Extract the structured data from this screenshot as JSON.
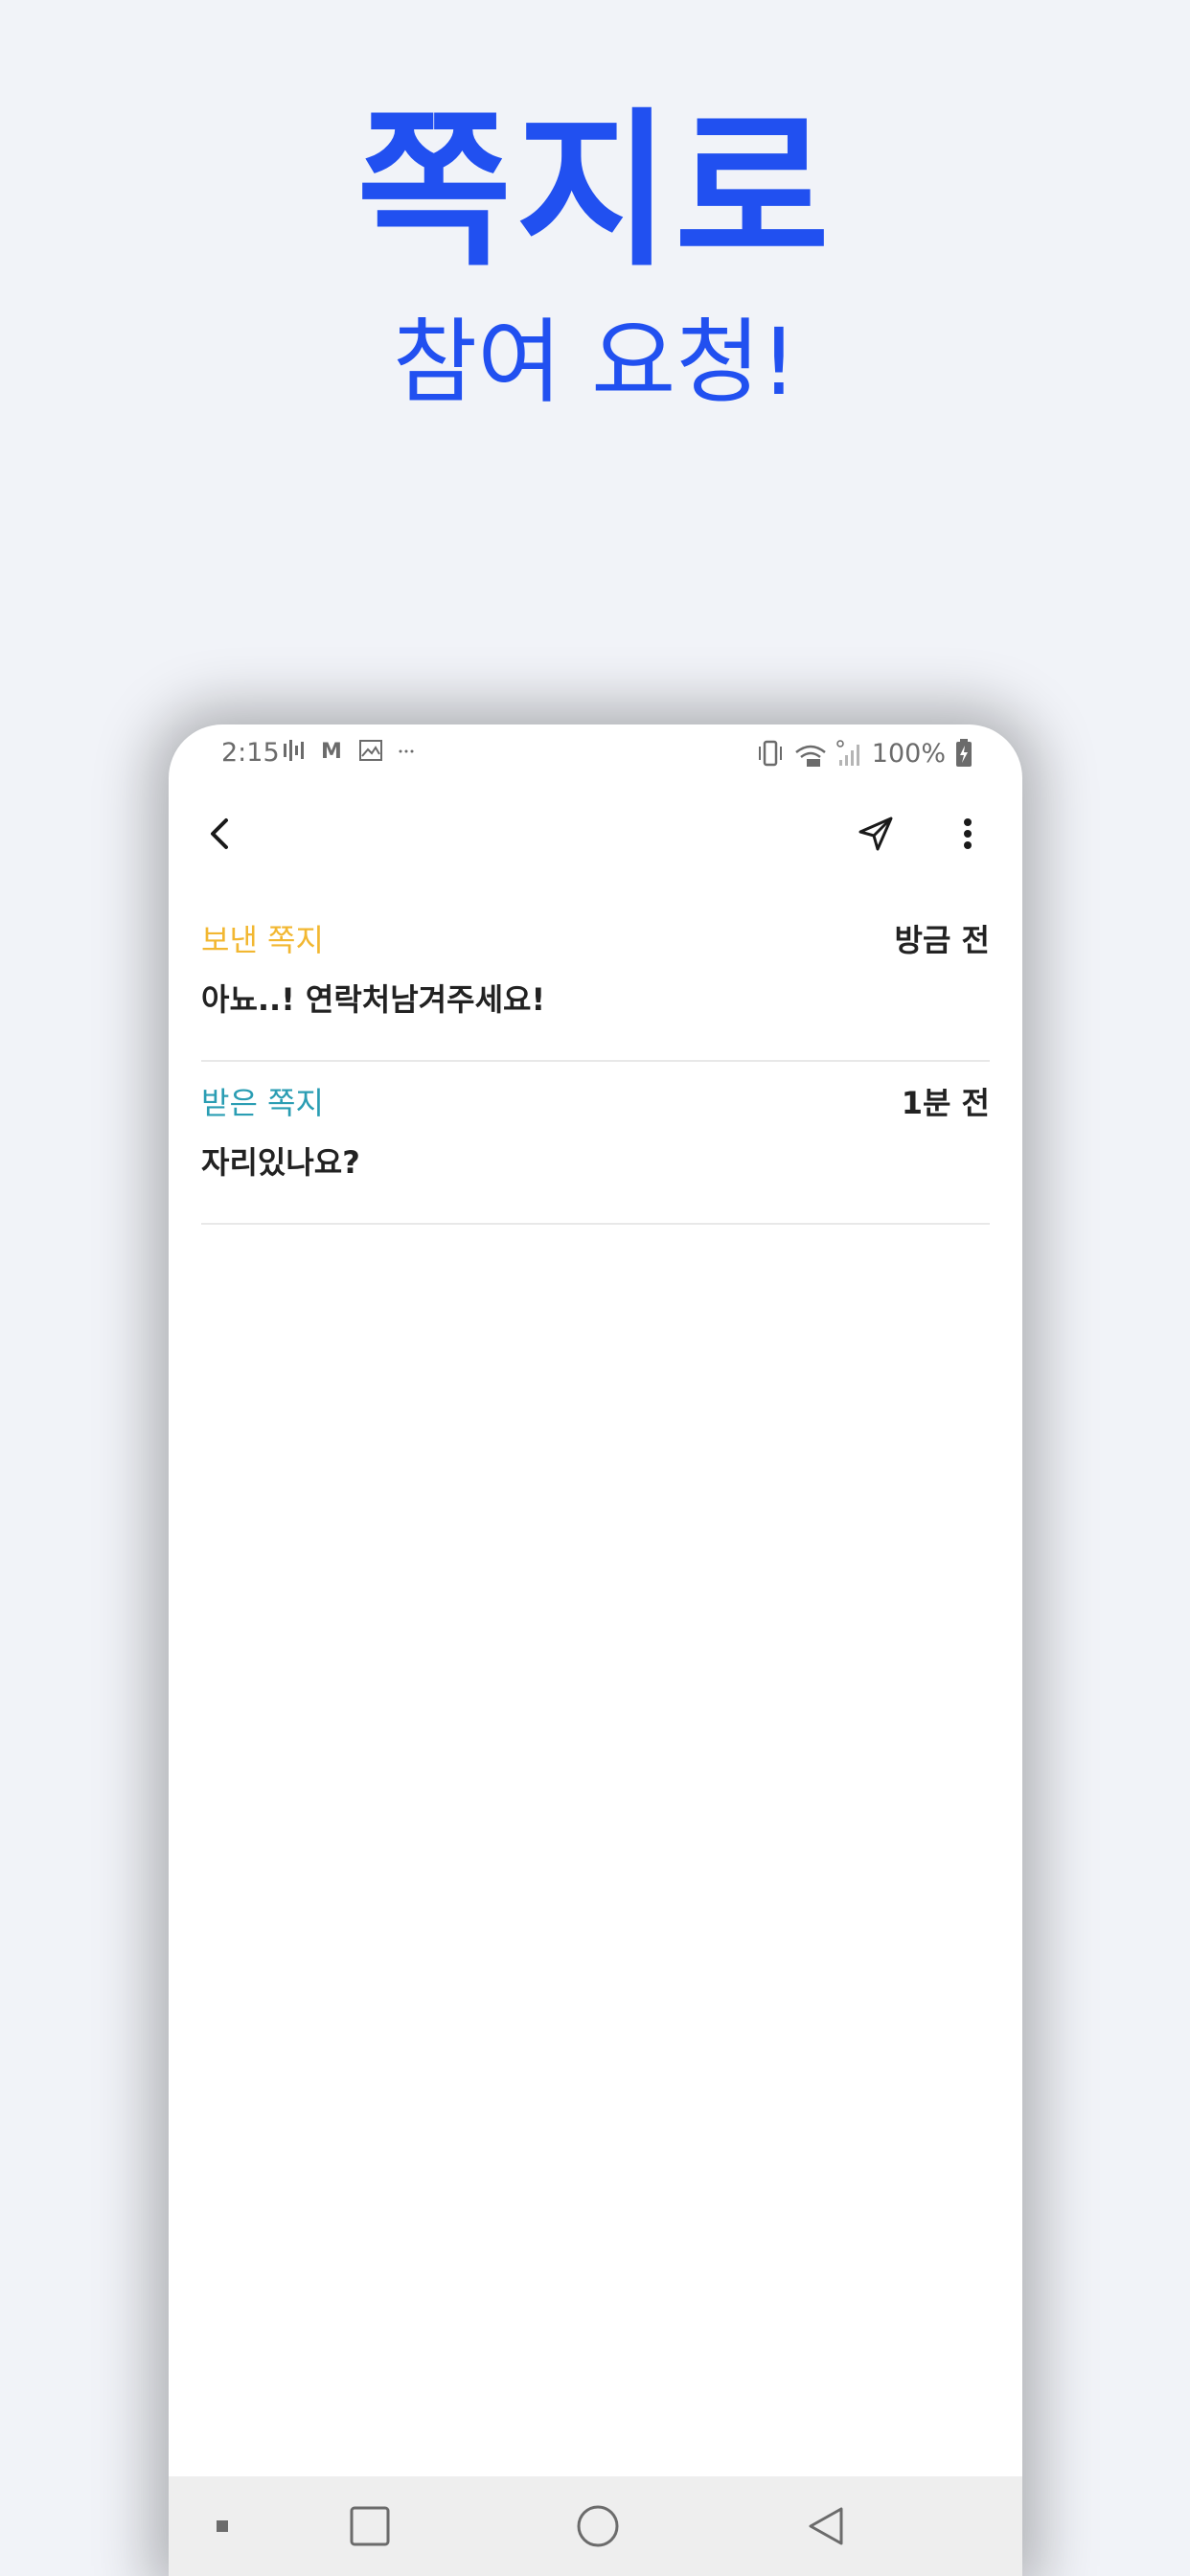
{
  "promo": {
    "headline": "쪽지로",
    "subheadline": "참여 요청!"
  },
  "status_bar": {
    "time": "2:15",
    "battery": "100%"
  },
  "messages": [
    {
      "type": "보낸 쪽지",
      "time": "방금 전",
      "body": "아뇨..! 연락처남겨주세요!",
      "type_color": "#f2b731"
    },
    {
      "type": "받은 쪽지",
      "time": "1분 전",
      "body": "자리있나요?",
      "type_color": "#2a9db3"
    }
  ],
  "colors": {
    "accent": "#2150f0",
    "sent": "#f2b731",
    "received": "#2a9db3"
  }
}
